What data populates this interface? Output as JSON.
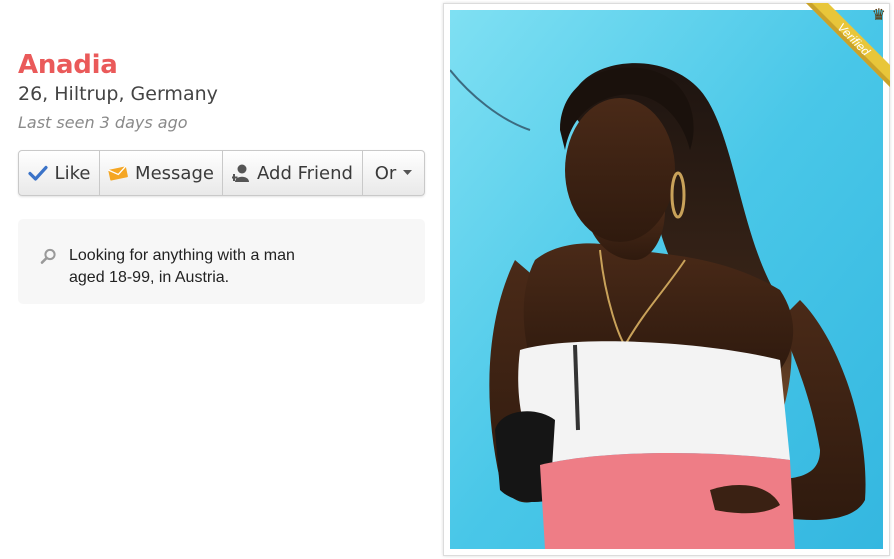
{
  "profile": {
    "name": "Anadia",
    "location": "26, Hiltrup, Germany",
    "last_seen": "Last seen 3 days ago"
  },
  "actions": {
    "like_label": "Like",
    "message_label": "Message",
    "add_friend_label": "Add Friend",
    "or_label": "Or"
  },
  "looking_for": {
    "text": "Looking for anything with a man aged 18-99, in Austria."
  },
  "photo": {
    "badge_label": "Verified"
  },
  "colors": {
    "name": "#ea5a5a",
    "like_check": "#3b73c8",
    "message_envelope": "#f5a623",
    "badge_gold": "#e8c63a"
  },
  "icons": [
    "check-icon",
    "envelope-icon",
    "add-person-icon",
    "caret-down-icon",
    "search-icon",
    "crown-icon"
  ]
}
